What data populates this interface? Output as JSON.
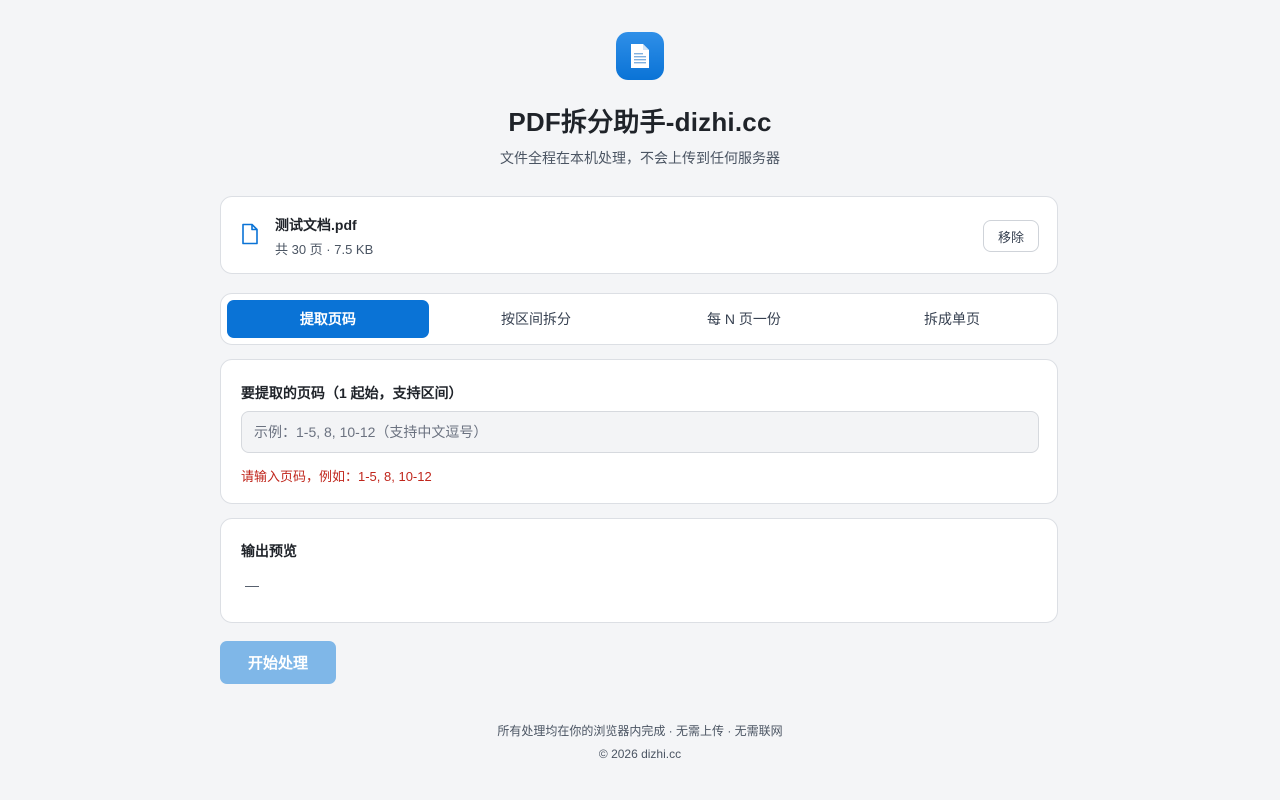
{
  "header": {
    "icon": "document-icon",
    "title": "PDF拆分助手-dizhi.cc",
    "subtitle": "文件全程在本机处理，不会上传到任何服务器"
  },
  "file": {
    "icon": "file-icon",
    "name": "测试文档.pdf",
    "meta": "共 30 页 · 7.5 KB",
    "remove_label": "移除"
  },
  "tabs": [
    {
      "label": "提取页码",
      "active": true
    },
    {
      "label": "按区间拆分",
      "active": false
    },
    {
      "label": "每 N 页一份",
      "active": false
    },
    {
      "label": "拆成单页",
      "active": false
    }
  ],
  "pages_input": {
    "label": "要提取的页码（1 起始，支持区间）",
    "placeholder": "示例：1-5, 8, 10-12（支持中文逗号）",
    "value": "",
    "error": "请输入页码，例如：1-5, 8, 10-12"
  },
  "preview": {
    "title": "输出预览",
    "empty_text": "—"
  },
  "start_button": {
    "label": "开始处理"
  },
  "footer": {
    "line1": "所有处理均在你的浏览器内完成 · 无需上传 · 无需联网",
    "line2": "© 2026 dizhi.cc"
  },
  "colors": {
    "accent": "#0a73d6",
    "error": "#c0261c",
    "disabled_button": "#7fb7e8",
    "background": "#f4f5f7"
  }
}
